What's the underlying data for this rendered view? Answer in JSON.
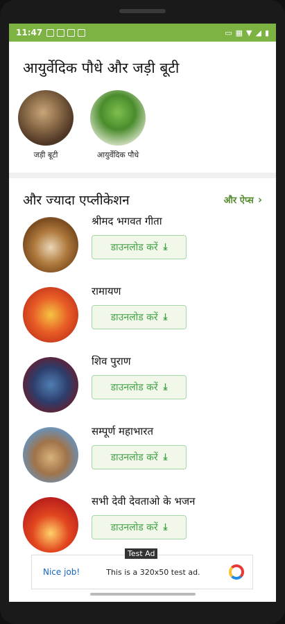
{
  "status_bar": {
    "time": "11:47",
    "accent_color": "#7cb342"
  },
  "header": {
    "title": "आयुर्वेदिक पौधे और जड़ी बूटी"
  },
  "categories": [
    {
      "label": "जड़ी बूटी",
      "icon": "herbs-image"
    },
    {
      "label": "आयुर्वेदिक पौधे",
      "icon": "plant-image"
    }
  ],
  "more_apps": {
    "title": "और ज्यादा एप्लीकेशन",
    "link_label": "और ऐप्स",
    "link_icon": "chevron-right-icon"
  },
  "apps": [
    {
      "name": "श्रीमद भगवत गीता",
      "button": "डाउनलोड करें"
    },
    {
      "name": "रामायण",
      "button": "डाउनलोड करें"
    },
    {
      "name": "शिव पुराण",
      "button": "डाउनलोड करें"
    },
    {
      "name": "सम्पूर्ण महाभारत",
      "button": "डाउनलोड करें"
    },
    {
      "name": "सभी देवी देवताओ के भजन",
      "button": "डाउनलोड करें"
    }
  ],
  "ad": {
    "tag": "Test Ad",
    "nice": "Nice job!",
    "text": "This is a 320x50 test ad."
  }
}
